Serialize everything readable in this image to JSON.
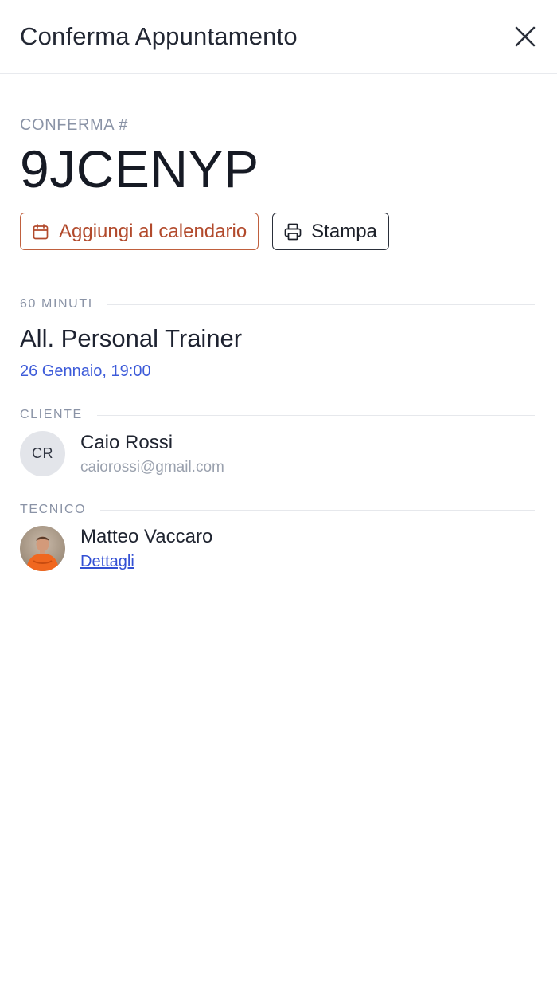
{
  "header": {
    "title": "Conferma Appuntamento",
    "close_icon": "close-icon"
  },
  "confirmation": {
    "label": "CONFERMA #",
    "code": "9JCENYP"
  },
  "actions": {
    "calendar_label": "Aggiungi al calendario",
    "calendar_icon": "calendar-icon",
    "print_label": "Stampa",
    "print_icon": "printer-icon"
  },
  "appointment": {
    "duration_label": "60 MINUTI",
    "service": "All. Personal Trainer",
    "datetime": "26 Gennaio, 19:00"
  },
  "client": {
    "section_label": "CLIENTE",
    "initials": "CR",
    "name": "Caio Rossi",
    "email": "caiorossi@gmail.com"
  },
  "technician": {
    "section_label": "TECNICO",
    "name": "Matteo Vaccaro",
    "link_label": "Dettagli"
  },
  "colors": {
    "accent_calendar": "#c0603e",
    "link_blue": "#3350d4",
    "date_blue": "#3d5bd9",
    "muted": "#8a93a6"
  }
}
